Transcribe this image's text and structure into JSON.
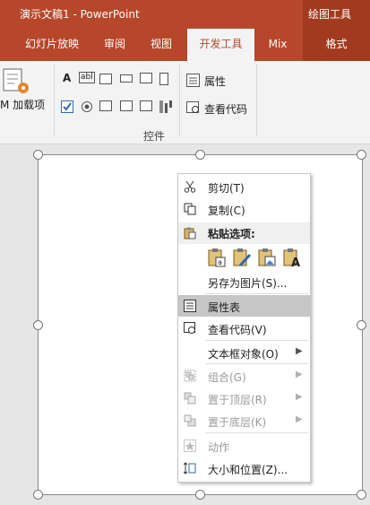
{
  "titlebar": {
    "title": "演示文稿1  -  PowerPoint",
    "contextual_tab_group": "绘图工具"
  },
  "tabs": [
    {
      "label": "幻灯片放映"
    },
    {
      "label": "审阅"
    },
    {
      "label": "视图"
    },
    {
      "label": "开发工具",
      "active": true
    },
    {
      "label": "Mix"
    },
    {
      "label": "格式"
    }
  ],
  "ribbon": {
    "addins_label": "M 加载项",
    "properties_label": "属性",
    "view_code_label": "查看代码",
    "controls_group_label": "控件",
    "label_control_glyph": "A",
    "textbox_control_glyph": "abl"
  },
  "context_menu": {
    "cut": "剪切(T)",
    "copy": "复制(C)",
    "paste_options": "粘贴选项:",
    "save_as_picture": "另存为图片(S)...",
    "property_sheet": "属性表",
    "view_code": "查看代码(V)",
    "textbox_object": "文本框对象(O)",
    "group": "组合(G)",
    "bring_to_front": "置于顶层(R)",
    "send_to_back": "置于底层(K)",
    "action": "动作",
    "size_position": "大小和位置(Z)..."
  },
  "colors": {
    "accent": "#b7472a",
    "contextual": "#a23a1f",
    "ribbon_bg": "#f3f3f3",
    "menu_highlight": "#c6c6c6"
  }
}
